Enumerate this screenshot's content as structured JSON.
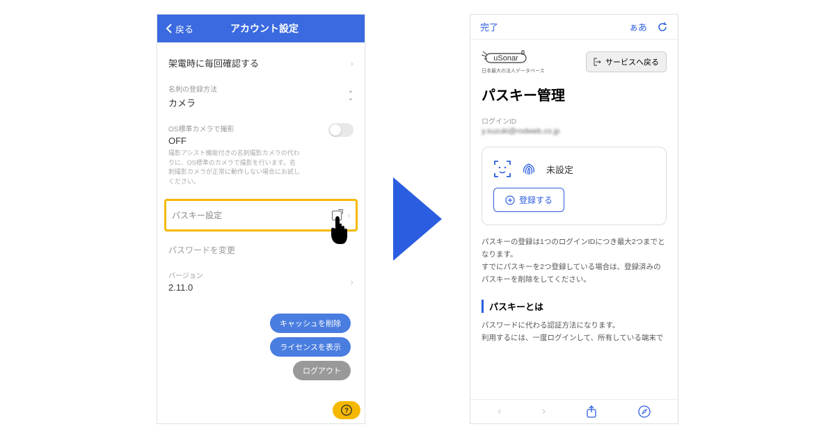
{
  "left": {
    "back": "戻る",
    "title": "アカウント設定",
    "row_check": "架電時に毎回確認する",
    "card_reg_label": "名刺の登録方法",
    "card_reg_value": "カメラ",
    "os_cam_label": "OS標準カメラで撮影",
    "os_cam_value": "OFF",
    "os_cam_desc": "撮影アシスト機能付きの名刺撮影カメラの代わりに、OS標準のカメラで撮影を行います。名刺撮影カメラが正常に動作しない場合にお試しください。",
    "passkey_setting": "パスキー設定",
    "change_pw": "パスワードを変更",
    "version_label": "バージョン",
    "version_value": "2.11.0",
    "btn_cache": "キャッシュを削除",
    "btn_license": "ライセンスを表示",
    "btn_logout": "ログアウト"
  },
  "right": {
    "done": "完了",
    "aa": "ぁあ",
    "logo_main": "uSonar",
    "logo_sub": "日本最大の法人データベース",
    "svc_back": "サービスへ戻る",
    "h1": "パスキー管理",
    "login_id_label": "ログインID",
    "login_id_value": "y.suzuki@rodweb.co.jp",
    "status": "未設定",
    "register": "登録する",
    "info": "パスキーの登録は1つのログインIDにつき最大2つまでとなります。\nすでにパスキーを2つ登録している場合は、登録済みのパスキーを削除をしてください。",
    "section": "パスキーとは",
    "section_body": "パスワードに代わる認証方法になります。\n利用するには、一度ログインして、所有している端末で"
  }
}
